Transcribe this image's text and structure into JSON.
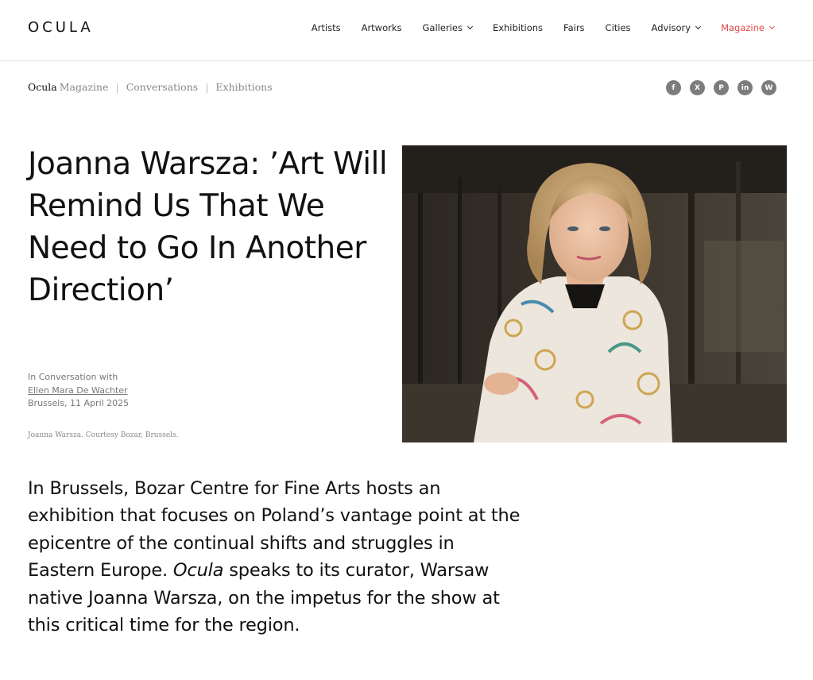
{
  "header": {
    "logo": "OCULA",
    "nav": [
      {
        "label": "Artists",
        "dropdown": false,
        "active": false
      },
      {
        "label": "Artworks",
        "dropdown": false,
        "active": false
      },
      {
        "label": "Galleries",
        "dropdown": true,
        "active": false
      },
      {
        "label": "Exhibitions",
        "dropdown": false,
        "active": false
      },
      {
        "label": "Fairs",
        "dropdown": false,
        "active": false
      },
      {
        "label": "Cities",
        "dropdown": false,
        "active": false
      },
      {
        "label": "Advisory",
        "dropdown": true,
        "active": false
      },
      {
        "label": "Magazine",
        "dropdown": true,
        "active": true
      }
    ]
  },
  "breadcrumb": {
    "brand": "Ocula",
    "brand_sub": "Magazine",
    "items": [
      "Conversations",
      "Exhibitions"
    ]
  },
  "share": [
    {
      "icon": "facebook-icon",
      "glyph": "f"
    },
    {
      "icon": "x-icon",
      "glyph": "X"
    },
    {
      "icon": "pinterest-icon",
      "glyph": "P"
    },
    {
      "icon": "linkedin-icon",
      "glyph": "in"
    },
    {
      "icon": "whatsapp-icon",
      "glyph": "W"
    }
  ],
  "article": {
    "title": "Joanna Warsza: ’Art Will Remind Us That We Need to Go In Another Direction’",
    "meta_prefix": "In Conversation with",
    "author": "Ellen Mara De Wachter",
    "place_date": "Brussels, 11 April 2025",
    "image_caption": "Joanna Warsza. Courtesy Bozar, Brussels.",
    "lead_before": "In Brussels, Bozar Centre for Fine Arts hosts an exhibition that focuses on Poland’s vantage point at the epicentre of the continual shifts and struggles in Eastern Europe. ",
    "lead_em": "Ocula",
    "lead_after": " speaks to its curator, Warsaw native Joanna Warsza, on the impetus for the show at this critical time for the region."
  },
  "colors": {
    "accent": "#e0474c",
    "share_bg": "#7c7c7c"
  }
}
